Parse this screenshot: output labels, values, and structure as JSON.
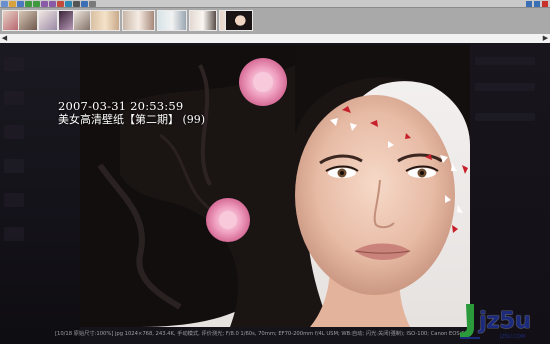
{
  "toolbar": {
    "buttons": [
      {
        "icon": "app-icon",
        "color": "#6a8fcf"
      },
      {
        "icon": "open-icon",
        "color": "#d8a33c"
      },
      {
        "icon": "save-icon",
        "color": "#4c78c0"
      },
      {
        "icon": "prev-icon",
        "color": "#3f9a3f"
      },
      {
        "icon": "next-icon",
        "color": "#3f9a3f"
      },
      {
        "icon": "zoom-in-icon",
        "color": "#8a5aa8"
      },
      {
        "icon": "zoom-out-icon",
        "color": "#8a5aa8"
      },
      {
        "icon": "rotate-icon",
        "color": "#c24b3c"
      },
      {
        "icon": "slideshow-icon",
        "color": "#2d87b0"
      },
      {
        "icon": "fullscreen-icon",
        "color": "#555555"
      },
      {
        "icon": "info-icon",
        "color": "#3b6fb5"
      },
      {
        "icon": "settings-icon",
        "color": "#7a7a7a"
      }
    ],
    "window_controls": [
      "minimize-icon",
      "maximize-icon",
      "close-icon"
    ]
  },
  "thumbnails": {
    "count": 11,
    "selected_index": 10
  },
  "overlay": {
    "datetime": "2007-03-31 20:53:59",
    "title": "美女高清壁纸【第二期】 (99)"
  },
  "exif_line": "[10/18 原始尺寸:100%] jpg 1024×768, 243.4K, 手动模式, 评价测光; F/8.0 1/60s, 70mm; EF70-200mm f/4L USM; WB:自动; 闪光:关闭(强制); ISO-100; Canon EOS 5D",
  "watermark": {
    "text": "jz5u",
    "url": "JZ5U.COM",
    "color": "#1b2a7a"
  }
}
